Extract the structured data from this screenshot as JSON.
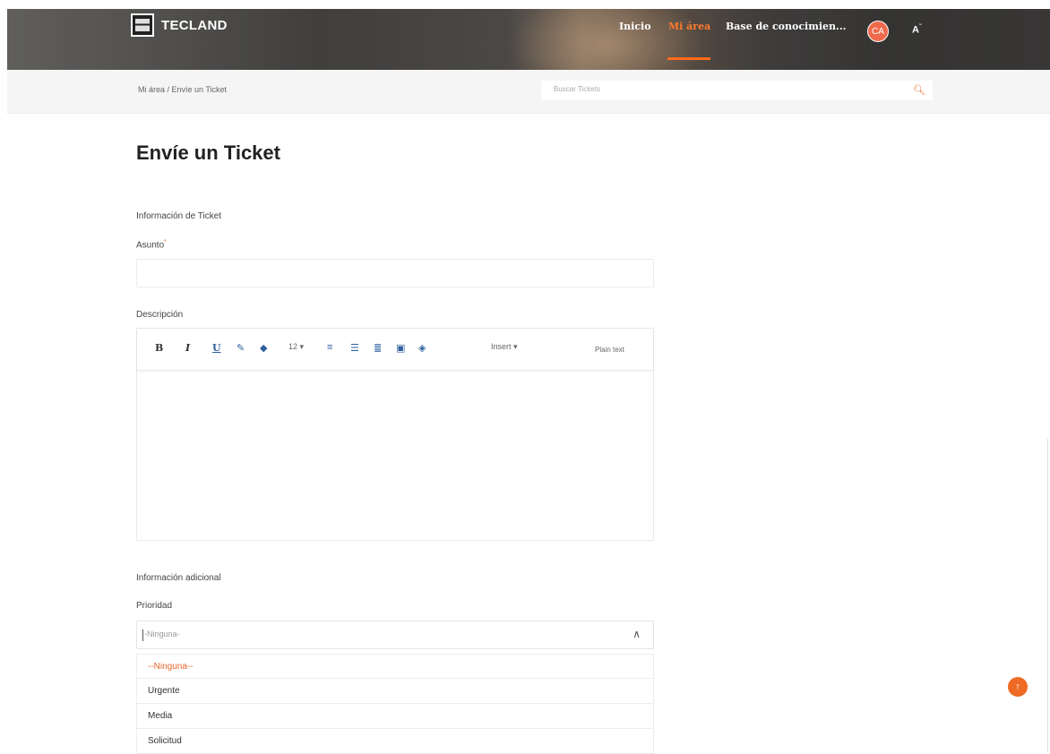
{
  "header": {
    "brand": "TECLAND",
    "nav": [
      "Inicio",
      "Mi área",
      "Base de conocimien..."
    ],
    "avatar": "CA",
    "accent": "#ff6a1a"
  },
  "breadcrumb": {
    "text": "Mi área  /  Envíe un Ticket"
  },
  "search": {
    "placeholder": "Buscar Tickets"
  },
  "page": {
    "title": "Envíe un Ticket"
  },
  "form": {
    "section1": "Información de Ticket",
    "asunto_label": "Asunto",
    "required_mark": "*",
    "descripcion_label": "Descripción",
    "toolbar": {
      "bold": "B",
      "italic": "I",
      "underline": "U",
      "font_size": "12 ▾",
      "insert": "Insert ▾",
      "plain_text": "Plain text"
    },
    "section2": "Información adicional",
    "prioridad_label": "Prioridad",
    "prioridad_value": "-Ninguna-",
    "options": [
      "--Ninguna--",
      "Urgente",
      "Media",
      "Solicitud"
    ]
  }
}
